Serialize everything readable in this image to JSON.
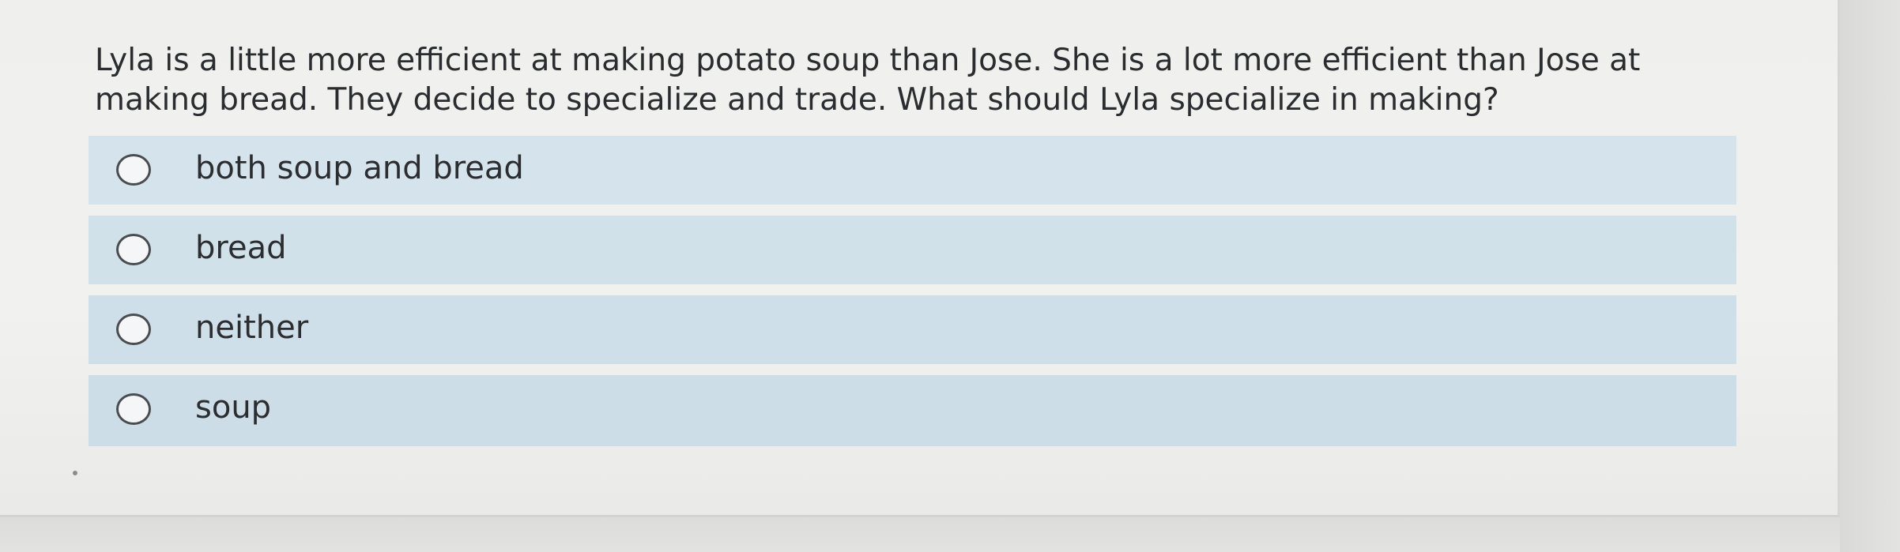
{
  "question": {
    "text": "Lyla is a little more efficient at making potato soup than Jose. She is a lot more efficient than Jose at making bread. They decide to specialize and trade. What should Lyla specialize in making?"
  },
  "options": [
    {
      "label": "both soup and bread",
      "selected": false
    },
    {
      "label": "bread",
      "selected": false
    },
    {
      "label": "neither",
      "selected": false
    },
    {
      "label": "soup",
      "selected": false
    }
  ],
  "colors": {
    "option_background": "#d4e3ec",
    "page_background": "#efefed",
    "text": "#2a2c2f"
  }
}
